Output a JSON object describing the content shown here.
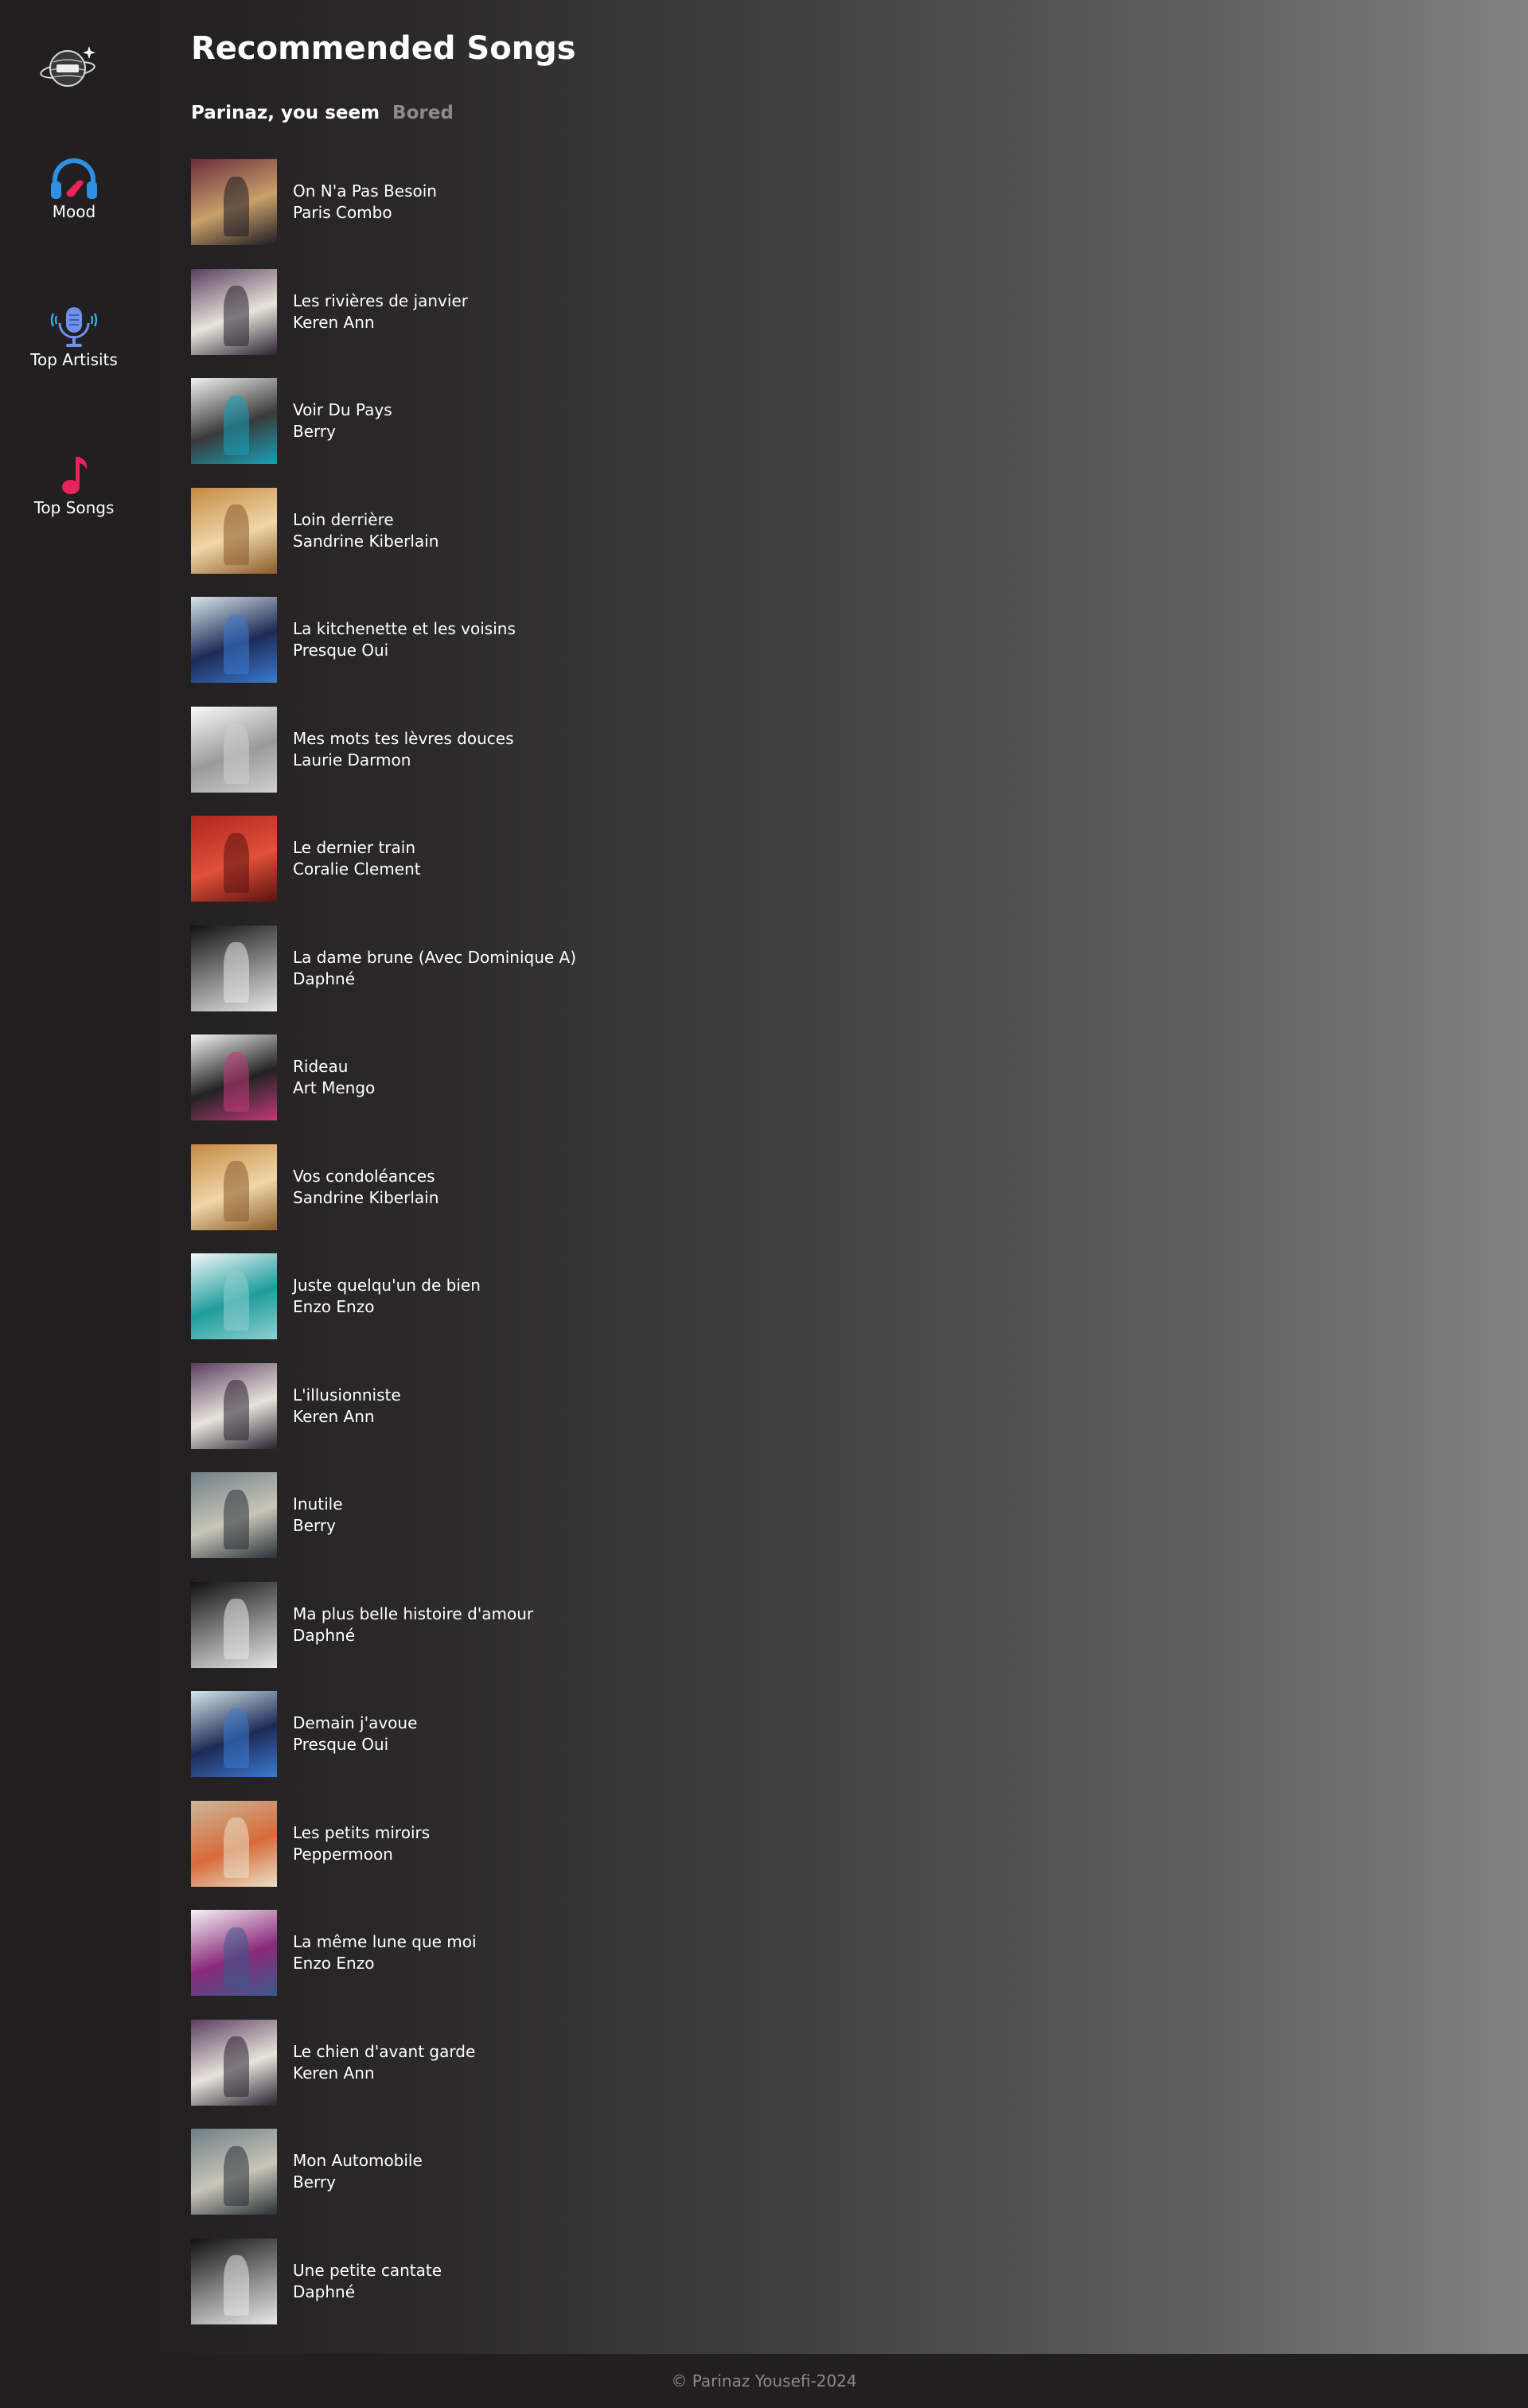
{
  "nav": {
    "items": [
      {
        "label": "Mood",
        "icon": "headphones-icon"
      },
      {
        "label": "Top Artisits",
        "icon": "microphone-icon"
      },
      {
        "label": "Top Songs",
        "icon": "music-note-icon"
      }
    ]
  },
  "main": {
    "title": "Recommended Songs",
    "greeting": "Parinaz, you seem",
    "mood": "Bored",
    "songs": [
      {
        "title": "On N'a Pas Besoin",
        "artist": "Paris Combo",
        "cover_colors": [
          "#6b2d3d",
          "#c9a06a",
          "#1d1b22"
        ]
      },
      {
        "title": "Les rivières de janvier",
        "artist": "Keren Ann",
        "cover_colors": [
          "#5a3f5f",
          "#e8e4dc",
          "#2a2030"
        ]
      },
      {
        "title": "Voir Du Pays",
        "artist": "Berry",
        "cover_colors": [
          "#f2f2f2",
          "#3a3a3a",
          "#18a0b8"
        ]
      },
      {
        "title": "Loin derrière",
        "artist": "Sandrine Kiberlain",
        "cover_colors": [
          "#c58a42",
          "#f0d6a8",
          "#8a5a2a"
        ]
      },
      {
        "title": "La kitchenette et les voisins",
        "artist": "Presque Oui",
        "cover_colors": [
          "#d8e6ea",
          "#1e2a56",
          "#3a7ad0"
        ]
      },
      {
        "title": "Mes mots tes lèvres douces",
        "artist": "Laurie Darmon",
        "cover_colors": [
          "#fafafa",
          "#9a9a9a",
          "#cfcfcf"
        ]
      },
      {
        "title": "Le dernier train",
        "artist": "Coralie Clement",
        "cover_colors": [
          "#b0261e",
          "#e0503a",
          "#5a120e"
        ]
      },
      {
        "title": "La dame brune (Avec Dominique A)",
        "artist": "Daphné",
        "cover_colors": [
          "#111111",
          "#8a8a8a",
          "#e8e8e8"
        ]
      },
      {
        "title": "Rideau",
        "artist": "Art Mengo",
        "cover_colors": [
          "#f4f4f4",
          "#222222",
          "#c23a7a"
        ]
      },
      {
        "title": "Vos condoléances",
        "artist": "Sandrine Kiberlain",
        "cover_colors": [
          "#c58a42",
          "#f0d6a8",
          "#8a5a2a"
        ]
      },
      {
        "title": "Juste quelqu'un de bien",
        "artist": "Enzo Enzo",
        "cover_colors": [
          "#f4f8f8",
          "#1f9c9c",
          "#8fd0d0"
        ]
      },
      {
        "title": "L'illusionniste",
        "artist": "Keren Ann",
        "cover_colors": [
          "#5a3f5f",
          "#e8e4dc",
          "#2a2030"
        ]
      },
      {
        "title": "Inutile",
        "artist": "Berry",
        "cover_colors": [
          "#6f7f86",
          "#c8c6b8",
          "#2a3038"
        ]
      },
      {
        "title": "Ma plus belle histoire d'amour",
        "artist": "Daphné",
        "cover_colors": [
          "#111111",
          "#8a8a8a",
          "#e8e8e8"
        ]
      },
      {
        "title": "Demain j'avoue",
        "artist": "Presque Oui",
        "cover_colors": [
          "#d8e6ea",
          "#1e2a56",
          "#3a7ad0"
        ]
      },
      {
        "title": "Les petits miroirs",
        "artist": "Peppermoon",
        "cover_colors": [
          "#cbb79a",
          "#d86a3a",
          "#e9e0c8"
        ]
      },
      {
        "title": "La même lune que moi",
        "artist": "Enzo Enzo",
        "cover_colors": [
          "#f6f2f6",
          "#8a2a7a",
          "#3a5a8a"
        ]
      },
      {
        "title": "Le chien d'avant garde",
        "artist": "Keren Ann",
        "cover_colors": [
          "#5a3f5f",
          "#e8e4dc",
          "#2a2030"
        ]
      },
      {
        "title": "Mon Automobile",
        "artist": "Berry",
        "cover_colors": [
          "#6f7f86",
          "#c8c6b8",
          "#2a3038"
        ]
      },
      {
        "title": "Une petite cantate",
        "artist": "Daphné",
        "cover_colors": [
          "#111111",
          "#8a8a8a",
          "#e8e8e8"
        ]
      }
    ]
  },
  "footer": {
    "text": "© Parinaz Yousefi-2024"
  },
  "colors": {
    "background": "#221f20",
    "muted_text": "#8c8a8b",
    "headphones": "#2f8fe0",
    "microphone": "#6f8fe8",
    "music_note": "#e8245a"
  }
}
